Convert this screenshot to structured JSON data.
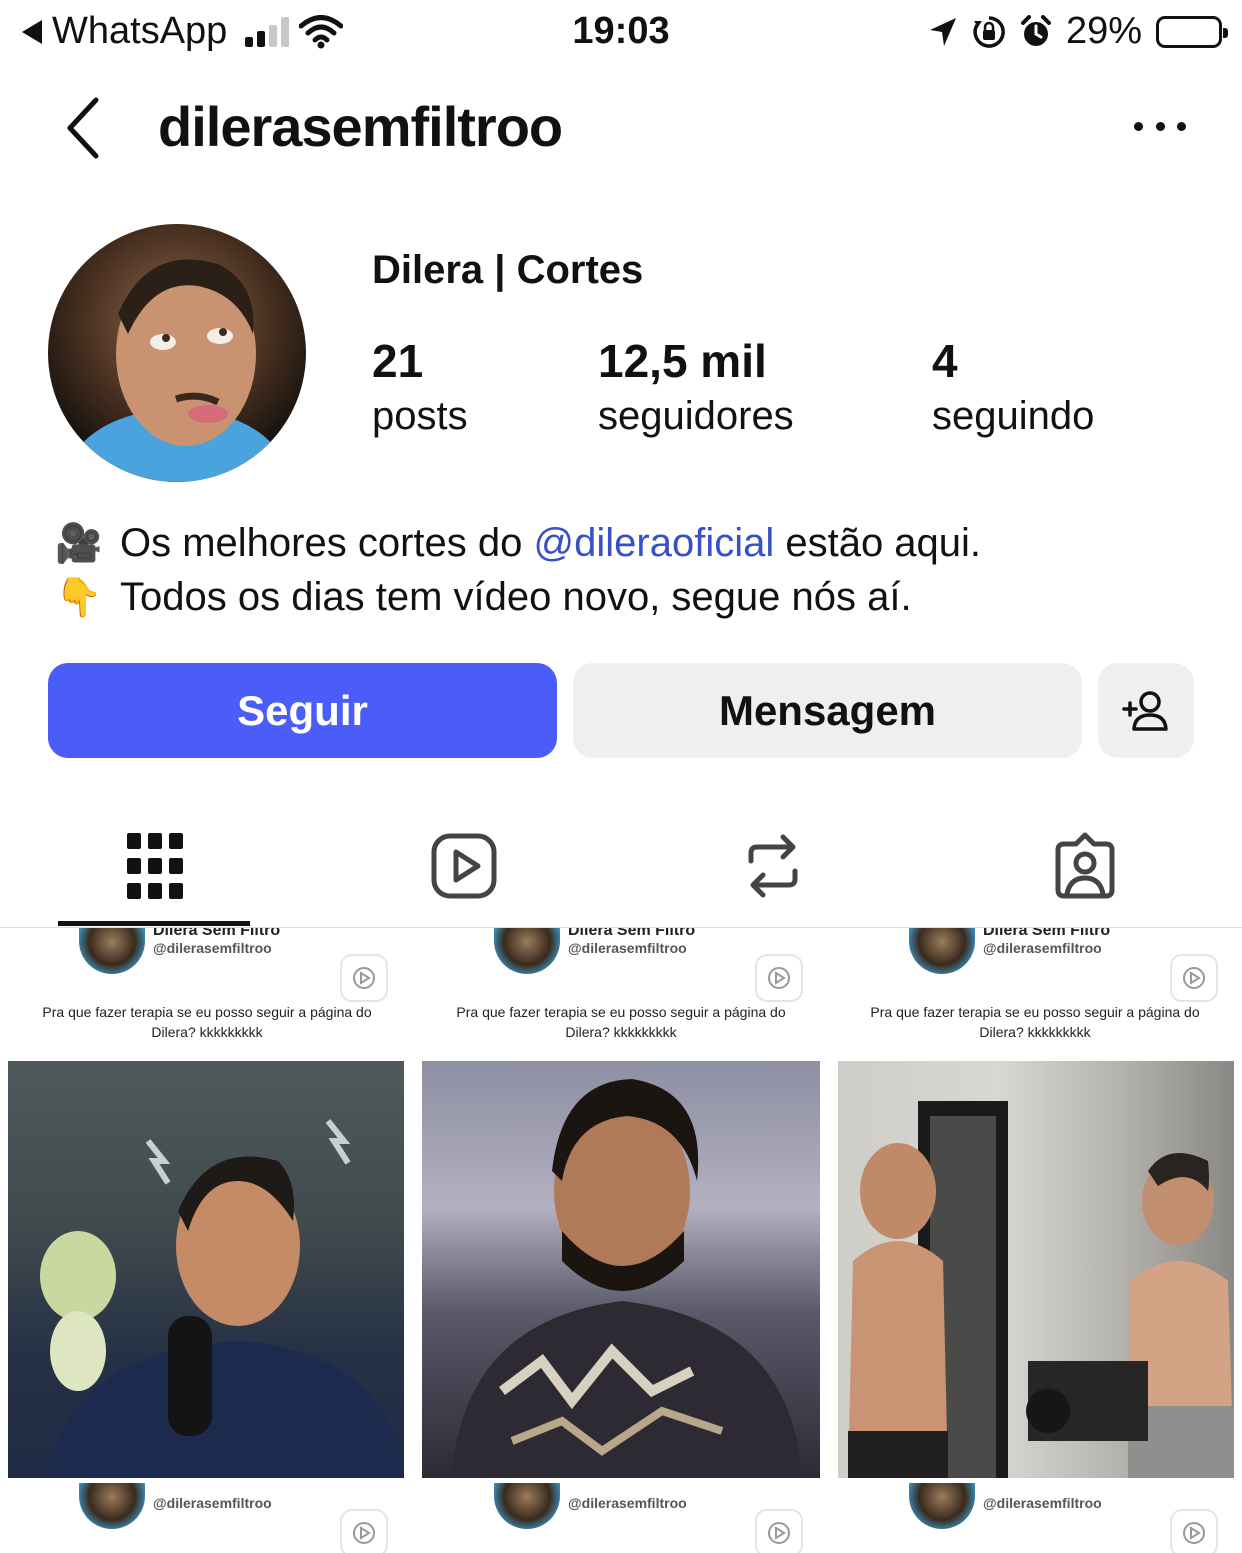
{
  "status_bar": {
    "back_app": "WhatsApp",
    "time": "19:03",
    "battery": "29%",
    "battery_level": 0.29
  },
  "header": {
    "username": "dilerasemfiltroo"
  },
  "profile": {
    "display_name": "Dilera | Cortes",
    "stats": [
      {
        "value": "21",
        "label": "posts"
      },
      {
        "value": "12,5 mil",
        "label": "seguidores"
      },
      {
        "value": "4",
        "label": "seguindo"
      }
    ],
    "bio": {
      "line1_emoji": "🎥",
      "line1_before": "Os melhores cortes do",
      "line1_mention": "@dileraoficial",
      "line1_after": "estão aqui.",
      "line2_emoji": "👇",
      "line2": "Todos os dias tem vídeo novo, segue nós aí."
    }
  },
  "actions": {
    "follow": "Seguir",
    "message": "Mensagem",
    "follow_color": "#4a5df9"
  },
  "tabs": [
    {
      "icon": "grid-icon",
      "active": true
    },
    {
      "icon": "reels-icon",
      "active": false
    },
    {
      "icon": "reposts-icon",
      "active": false
    },
    {
      "icon": "tagged-icon",
      "active": false
    }
  ],
  "posts": [
    {
      "brand": "Dilera Sem Filtro",
      "handle": "@dilerasemfiltroo",
      "caption": "Pra que fazer terapia se eu posso seguir a página do Dilera? kkkkkkkkk"
    },
    {
      "brand": "Dilera Sem Filtro",
      "handle": "@dilerasemfiltroo",
      "caption": "Pra que fazer terapia se eu posso seguir a página do Dilera? kkkkkkkkk"
    },
    {
      "brand": "Dilera Sem Filtro",
      "handle": "@dilerasemfiltroo",
      "caption": "Pra que fazer terapia se eu posso seguir a página do Dilera? kkkkkkkkk"
    }
  ]
}
